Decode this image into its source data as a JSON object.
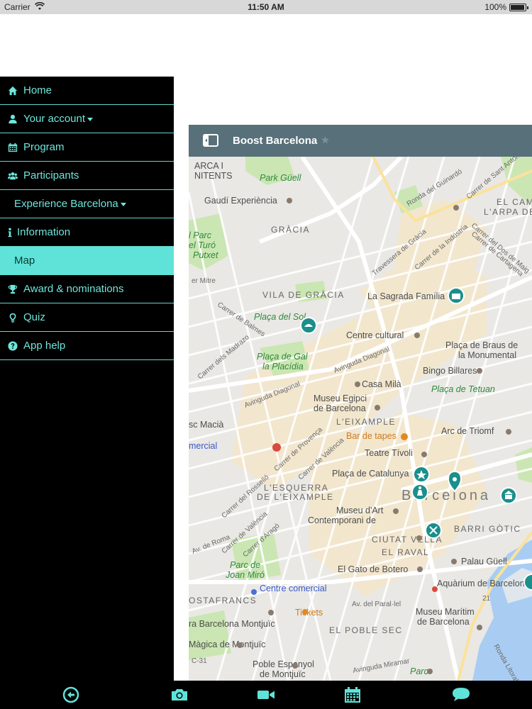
{
  "status": {
    "carrier": "Carrier",
    "time": "11:50 AM",
    "battery": "100%"
  },
  "menu": {
    "items": [
      {
        "label": "Home",
        "icon": "home-icon"
      },
      {
        "label": "Your account",
        "icon": "user-icon",
        "dropdown": true
      },
      {
        "label": "Program",
        "icon": "calendar-icon"
      },
      {
        "label": "Participants",
        "icon": "users-icon"
      },
      {
        "label": "Experience Barcelona",
        "dropdown": true
      },
      {
        "label": "Information",
        "icon": "info-icon"
      },
      {
        "label": "Map",
        "active": true
      },
      {
        "label": "Award & nominations",
        "icon": "trophy-icon"
      },
      {
        "label": "Quiz",
        "icon": "lightbulb-icon"
      },
      {
        "label": "App help",
        "icon": "question-icon"
      }
    ]
  },
  "map": {
    "title": "Boost Barcelona",
    "labels": {
      "park_guell": "Park Güell",
      "gaudi": "Gaudí Experiència",
      "gracia": "GRÀCIA",
      "parc_turo_1": "l Parc",
      "parc_turo_2": "el Turó",
      "parc_turo_3": "Putxet",
      "vila_gracia": "VILA DE GRÀCIA",
      "sagrada": "La Sagrada Família",
      "placa_sol": "Plaça del Sol",
      "centre_cultural": "Centre cultural",
      "placa_braus_1": "Plaça de Braus de",
      "placa_braus_2": "la Monumental",
      "placa_gal_1": "Plaça de Gal",
      "placa_gal_2": "la Placídia",
      "bingo": "Bingo Billares",
      "placa_tetuan": "Plaça de Tetuan",
      "casa_mila": "Casa Milà",
      "museu_egipci_1": "Museu Egipci",
      "museu_egipci_2": "de Barcelona",
      "eixample": "L'EIXAMPLE",
      "macia": "sc Macià",
      "bar_tapes": "Bar de tapes",
      "arc_triomf": "Arc de Triomf",
      "comercial": "mercial",
      "teatre_tivoli": "Teatre Tívoli",
      "placa_catalunya": "Plaça de Catalunya",
      "esquerra_1": "L'ESQUERRA",
      "esquerra_2": "DE L'EIXAMPLE",
      "barcelona": "Barcelona",
      "museu_art_1": "Museu d'Art",
      "museu_art_2": "Contemporani de",
      "barri_gotic": "BARRI GÒTIC",
      "ciutat_vella": "CIUTAT VELLA",
      "el_raval": "EL RAVAL",
      "parc_miro_1": "Parc de",
      "parc_miro_2": "Joan Miró",
      "gato_botero": "El Gato de Botero",
      "palau_guell": "Palau Güell",
      "aquarium": "Aquàrium de Barcelon",
      "centre_comercial": "Centre comercial",
      "hostafrancs": "OSTAFRANCS",
      "tickets": "Tickets",
      "museu_maritim_1": "Museu Marítim",
      "museu_maritim_2": "de Barcelona",
      "montjuic": "ra Barcelona Montjuïc",
      "el_poble_sec": "EL POBLE SEC",
      "magica": "Màgica de Montjuïc",
      "poble_espanyol_1": "Poble Espanyol",
      "poble_espanyol_2": "de Montjuïc",
      "parc": "Parc",
      "el_cam": "EL CAM",
      "arpa": "L'ARPA DE",
      "arca_1": "ARCA I",
      "arca_2": "NITENTS",
      "streets": {
        "guinardo": "Ronda del Guinardó",
        "sant_antoni": "Carrer de Sant Antoni",
        "travessera": "Travessera de Gràcia",
        "industria": "Carrer de la Indústria",
        "dos_maig": "Carrer del Dos de Maig",
        "cartagena": "Carrer de Cartagena",
        "mitre": "er Mitre",
        "balmes": "Carrer de Balmes",
        "madrazo": "Carrer dels Madrazo",
        "diagonal_1": "Avinguda Diagonal",
        "diagonal_2": "Avinguda Diagonal",
        "provenca": "Carrer de Provença",
        "valencia_1": "Carrer de València",
        "rossello": "Carrer del Rosselló",
        "valencia_2": "Carrer de València",
        "arago": "Carrer d'Aragó",
        "roma": "Av. de Roma",
        "parallel": "Av. del Paral·lel",
        "miramar": "Avinguda Miramar",
        "ronda_litoral": "Ronda Litoral",
        "c31": "C-31",
        "b21": "21"
      }
    }
  },
  "tabs": [
    {
      "icon": "back-arrow-icon"
    },
    {
      "icon": "camera-icon"
    },
    {
      "icon": "video-icon"
    },
    {
      "icon": "calendar-icon"
    },
    {
      "icon": "chat-icon"
    }
  ],
  "colors": {
    "accent": "#5fe3d8",
    "sidebar_bg": "#000000",
    "header_bg": "#587079",
    "marker": "#1a8f8c"
  }
}
